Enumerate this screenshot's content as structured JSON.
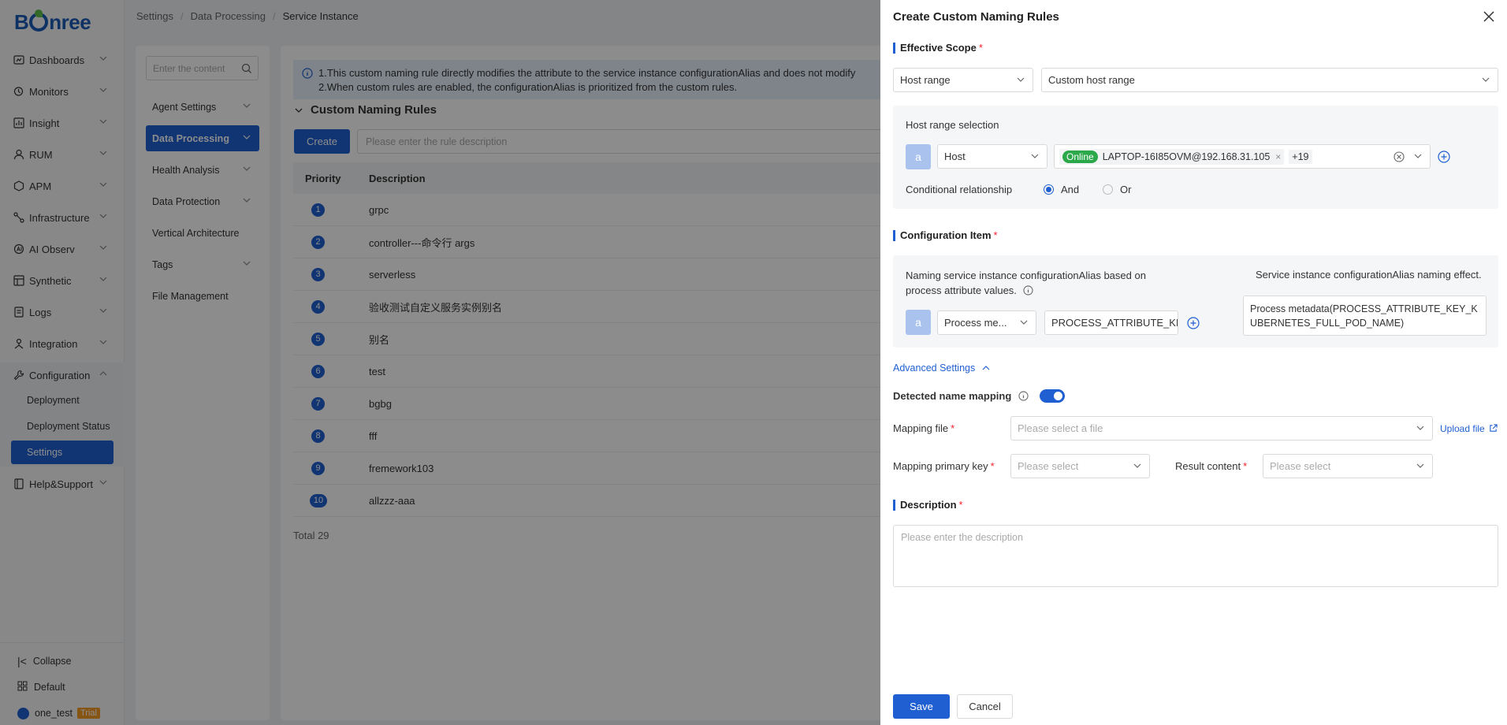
{
  "brand": {
    "logo_text_pre": "B",
    "logo_text_post": "nree",
    "accent": "#1f5fd1"
  },
  "sidebar": {
    "items": [
      {
        "label": "Dashboards",
        "icon": "dashboard-icon"
      },
      {
        "label": "Monitors",
        "icon": "monitor-icon"
      },
      {
        "label": "Insight",
        "icon": "insight-icon"
      },
      {
        "label": "RUM",
        "icon": "rum-icon"
      },
      {
        "label": "APM",
        "icon": "apm-icon"
      },
      {
        "label": "Infrastructure",
        "icon": "infrastructure-icon"
      },
      {
        "label": "AI Observ",
        "icon": "ai-icon"
      },
      {
        "label": "Synthetic",
        "icon": "synthetic-icon"
      },
      {
        "label": "Logs",
        "icon": "logs-icon"
      },
      {
        "label": "Integration",
        "icon": "integration-icon"
      },
      {
        "label": "Configuration",
        "icon": "configuration-icon"
      }
    ],
    "config_children": [
      "Deployment",
      "Deployment Status",
      "Settings"
    ],
    "help": "Help&Support",
    "collapse": "Collapse",
    "workspace": "Default",
    "user": "one_test",
    "user_badge": "Trial"
  },
  "breadcrumb": [
    "Settings",
    "Data Processing",
    "Service Instance"
  ],
  "submenu": {
    "search_placeholder": "Enter the content",
    "items": [
      "Agent Settings",
      "Data Processing",
      "Health Analysis",
      "Data Protection",
      "Vertical Architecture",
      "Tags",
      "File Management"
    ]
  },
  "main": {
    "notice_line1": "1.This custom naming rule directly modifies the attribute to the service instance configurationAlias and does not modify",
    "notice_line2": "2.When custom rules are enabled, the configurationAlias is prioritized from the custom rules.",
    "section_title": "Custom Naming Rules",
    "create_label": "Create",
    "desc_placeholder": "Please enter the rule description",
    "columns": [
      "Priority",
      "Description"
    ],
    "rows": [
      {
        "priority": "1",
        "desc": "grpc"
      },
      {
        "priority": "2",
        "desc": "controller---命令行 args"
      },
      {
        "priority": "3",
        "desc": "serverless"
      },
      {
        "priority": "4",
        "desc": "验收测试自定义服务实例别名"
      },
      {
        "priority": "5",
        "desc": "别名"
      },
      {
        "priority": "6",
        "desc": "test"
      },
      {
        "priority": "7",
        "desc": "bgbg"
      },
      {
        "priority": "8",
        "desc": "fff"
      },
      {
        "priority": "9",
        "desc": "fremework103"
      },
      {
        "priority": "10",
        "desc": "allzzz-aaa"
      }
    ],
    "total": "Total 29"
  },
  "drawer": {
    "title": "Create Custom Naming Rules",
    "effective_scope": "Effective Scope",
    "scope_type": "Host range",
    "scope_value": "Custom host range",
    "host_range_selection": "Host range selection",
    "cond_letter": "a",
    "host_field": "Host",
    "host_status": "Online",
    "host_value": "LAPTOP-16I85OVM@192.168.31.105",
    "host_more": "+19",
    "cond_rel_label": "Conditional relationship",
    "and_label": "And",
    "or_label": "Or",
    "config_item": "Configuration Item",
    "naming_desc": "Naming service instance configurationAlias based on process attribute values.",
    "effect_label": "Service instance configurationAlias naming effect.",
    "attr_field": "Process me...",
    "attr_value": "PROCESS_ATTRIBUTE_KEY",
    "effect_text": "Process metadata(PROCESS_ATTRIBUTE_KEY_KUBERNETES_FULL_POD_NAME)",
    "advanced": "Advanced Settings",
    "detected_mapping": "Detected name mapping",
    "mapping_enabled": true,
    "mapping_file_label": "Mapping file",
    "mapping_file_ph": "Please select a file",
    "upload_file": "Upload file",
    "primary_key_label": "Mapping primary key",
    "primary_key_ph": "Please select",
    "result_label": "Result content",
    "result_ph": "Please select",
    "description_title": "Description",
    "description_ph": "Please enter the description",
    "save": "Save",
    "cancel": "Cancel"
  }
}
